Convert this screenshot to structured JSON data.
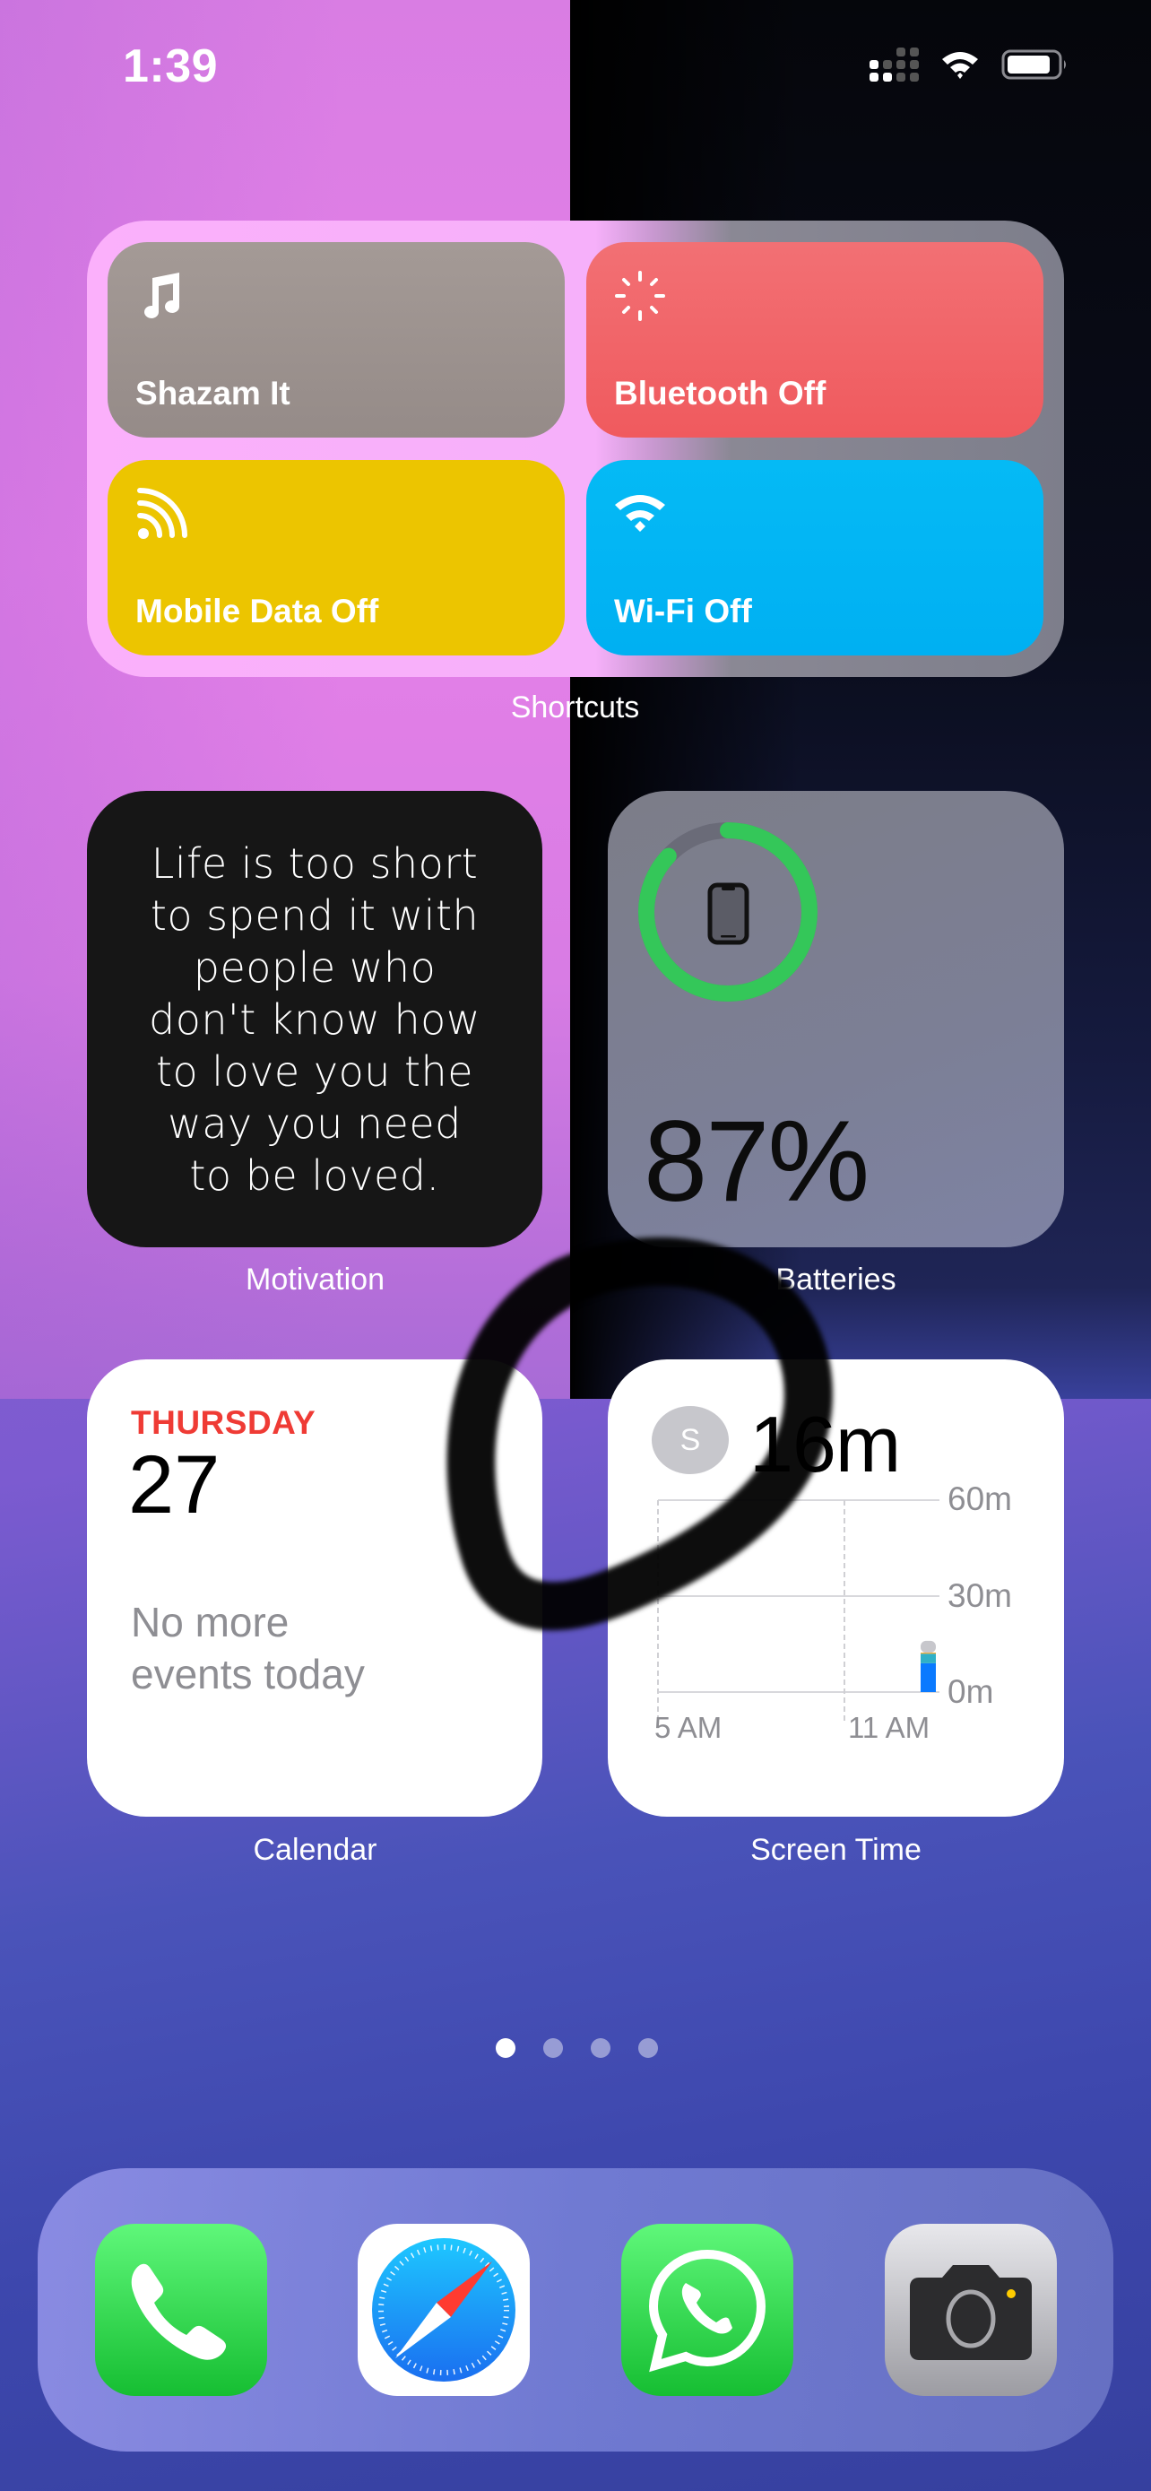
{
  "status_bar": {
    "time": "1:39",
    "signal_bars_active": 2,
    "signal_bars_total": 4,
    "wifi": "wifi-icon",
    "battery_level": 0.87
  },
  "widgets": {
    "shortcuts": {
      "label": "Shortcuts",
      "tiles": [
        {
          "label": "Shazam It",
          "icon": "music-note-icon",
          "color": "#9e9591"
        },
        {
          "label": "Bluetooth Off",
          "icon": "bluetooth-sparkle-icon",
          "color": "#f2656a"
        },
        {
          "label": "Mobile Data Off",
          "icon": "mobile-data-icon",
          "color": "#ecc500"
        },
        {
          "label": "Wi-Fi Off",
          "icon": "wifi-icon",
          "color": "#03b5f4"
        }
      ]
    },
    "motivation": {
      "label": "Motivation",
      "quote_lines": [
        "Life is too short",
        "to spend it with",
        "people who",
        "don't know how",
        "to love you the",
        "way you need",
        "to be loved."
      ]
    },
    "batteries": {
      "label": "Batteries",
      "percent_text": "87%",
      "level": 0.87,
      "device_icon": "iphone-icon",
      "ring_color": "#34c759"
    },
    "calendar": {
      "label": "Calendar",
      "weekday": "THURSDAY",
      "date": "27",
      "events_text": "No more\nevents today",
      "accent": "#ef3b35"
    },
    "screen_time": {
      "label": "Screen Time",
      "avatar_initial": "S",
      "total": "16m",
      "y_ticks": [
        "60m",
        "30m",
        "0m"
      ],
      "x_ticks": [
        "5 AM",
        "11 AM"
      ]
    }
  },
  "chart_data": {
    "type": "bar",
    "title": "Screen Time",
    "x": [
      "5 AM",
      "11 AM"
    ],
    "ylim": [
      0,
      60
    ],
    "yunit": "minutes",
    "y_ticks": [
      0,
      30,
      60
    ],
    "stacked": true,
    "bars": [
      {
        "x_position": "just before 12 PM",
        "segments": [
          {
            "category": "blue",
            "color": "#0a7aff",
            "minutes": 9
          },
          {
            "category": "teal",
            "color": "#30b0c7",
            "minutes": 3
          },
          {
            "category": "orange",
            "color": "#ff9f0a",
            "minutes": 0.3
          },
          {
            "category": "gray",
            "color": "#c7c7cc",
            "minutes": 3.7
          }
        ]
      }
    ],
    "total_minutes": 16
  },
  "page_indicator": {
    "count": 4,
    "active_index": 0
  },
  "dock": {
    "apps": [
      {
        "name": "Phone",
        "icon": "phone-app-icon"
      },
      {
        "name": "Safari",
        "icon": "safari-app-icon"
      },
      {
        "name": "WhatsApp",
        "icon": "whatsapp-app-icon"
      },
      {
        "name": "Camera",
        "icon": "camera-app-icon"
      }
    ]
  },
  "annotation": {
    "type": "hand-drawn circle",
    "color": "#000000"
  }
}
